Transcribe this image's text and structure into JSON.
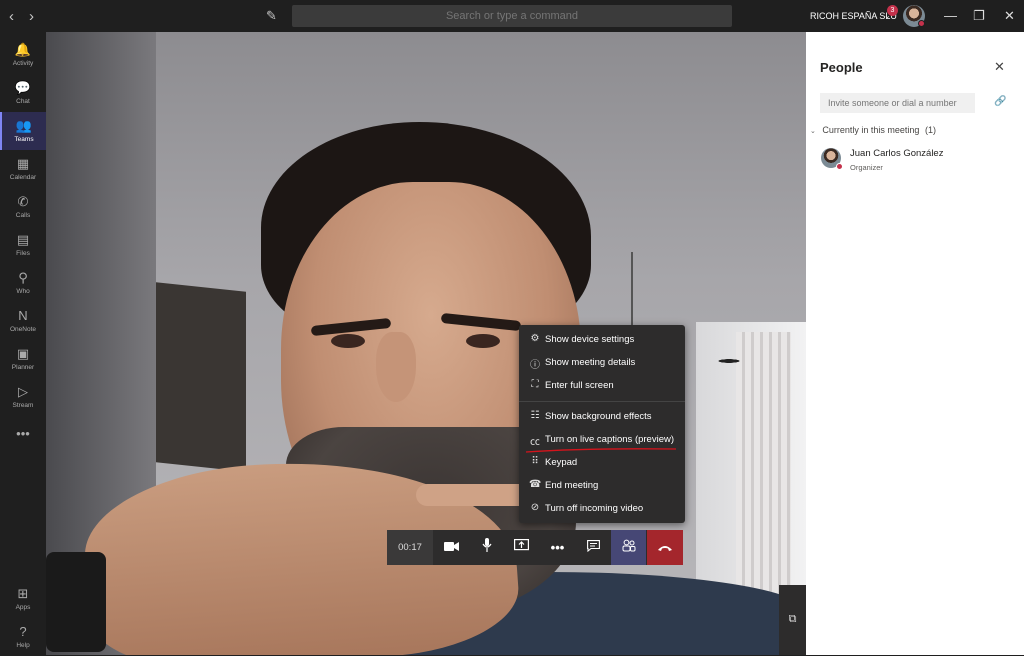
{
  "titlebar": {
    "back_icon": "chevron-left-icon",
    "forward_icon": "chevron-right-icon",
    "compose_icon": "compose-icon",
    "search_placeholder": "Search or type a command",
    "org_name": "RICOH ESPAÑA SLU",
    "notification_count": "3",
    "minimize": "—",
    "maximize": "❐",
    "close": "✕"
  },
  "rail": {
    "items": [
      {
        "label": "Activity",
        "icon": "bell-icon",
        "glyph": "🔔"
      },
      {
        "label": "Chat",
        "icon": "chat-icon",
        "glyph": "💬"
      },
      {
        "label": "Teams",
        "icon": "teams-icon",
        "glyph": "👥"
      },
      {
        "label": "Calendar",
        "icon": "calendar-icon",
        "glyph": "▦"
      },
      {
        "label": "Calls",
        "icon": "phone-icon",
        "glyph": "✆"
      },
      {
        "label": "Files",
        "icon": "file-icon",
        "glyph": "▤"
      },
      {
        "label": "Who",
        "icon": "who-icon",
        "glyph": "⚲"
      },
      {
        "label": "OneNote",
        "icon": "onenote-icon",
        "glyph": "N"
      },
      {
        "label": "Planner",
        "icon": "planner-icon",
        "glyph": "▣"
      },
      {
        "label": "Stream",
        "icon": "stream-icon",
        "glyph": "▷"
      }
    ],
    "more": "•••",
    "apps_label": "Apps",
    "help_label": "Help"
  },
  "menu": {
    "items": [
      {
        "label": "Show device settings",
        "icon": "gear-icon",
        "glyph": "⚙"
      },
      {
        "label": "Show meeting details",
        "icon": "info-icon",
        "glyph": "ⓘ"
      },
      {
        "label": "Enter full screen",
        "icon": "fullscreen-icon",
        "glyph": "⛶"
      },
      {
        "label": "Show background effects",
        "icon": "background-effects-icon",
        "glyph": "☷"
      },
      {
        "label": "Turn on live captions (preview)",
        "icon": "captions-icon",
        "glyph": "㏄"
      },
      {
        "label": "Keypad",
        "icon": "keypad-icon",
        "glyph": "⠿"
      },
      {
        "label": "End meeting",
        "icon": "end-meeting-icon",
        "glyph": "☎"
      },
      {
        "label": "Turn off incoming video",
        "icon": "video-off-icon",
        "glyph": "⊘"
      }
    ]
  },
  "callbar": {
    "timer": "00:17",
    "camera_icon": "video-camera-icon",
    "mic_icon": "microphone-icon",
    "share_icon": "share-screen-icon",
    "more_icon": "more-icon",
    "chat_icon": "conversation-icon",
    "people_icon": "participants-icon",
    "hangup_icon": "hang-up-icon"
  },
  "panel": {
    "title": "People",
    "invite_placeholder": "Invite someone or dial a number",
    "section_label": "Currently in this meeting",
    "section_count": "(1)",
    "participants": [
      {
        "name": "Juan Carlos González",
        "role": "Organizer"
      }
    ]
  },
  "colors": {
    "accent": "#464775",
    "hangup": "#a4262c",
    "rail_active": "#7f85f5",
    "status_busy": "#c4314b"
  }
}
